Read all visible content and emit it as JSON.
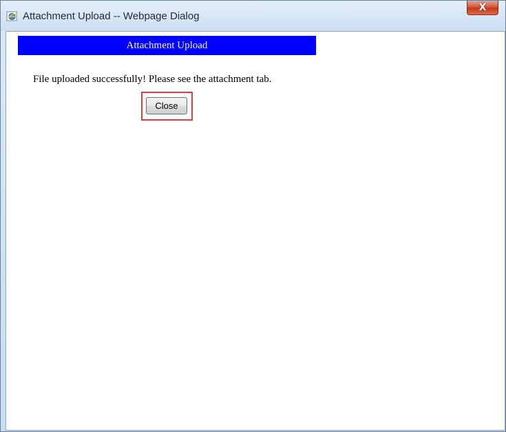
{
  "window": {
    "title": "Attachment Upload -- Webpage Dialog",
    "close_glyph": "X"
  },
  "page": {
    "header": "Attachment Upload",
    "message": "File uploaded successfully! Please see the attachment tab.",
    "close_button_label": "Close"
  },
  "icons": {
    "app": "ie-globe-icon",
    "window_close": "close-icon"
  },
  "colors": {
    "header_bg": "#0000ff",
    "header_text": "#ffffff",
    "highlight": "#e0423a"
  }
}
